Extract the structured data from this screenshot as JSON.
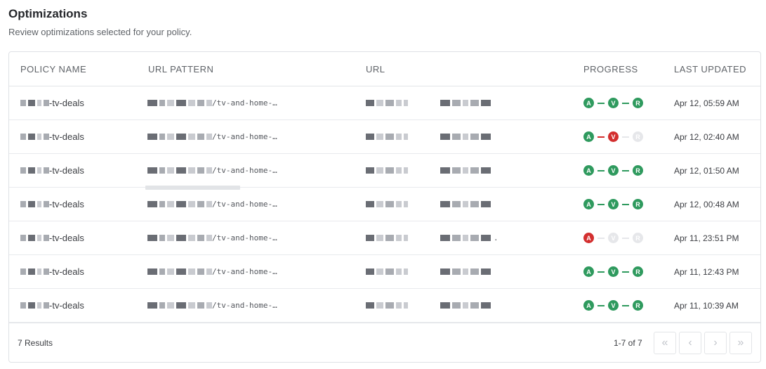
{
  "page": {
    "title": "Optimizations",
    "subtitle": "Review optimizations selected for your policy."
  },
  "table": {
    "headers": {
      "policy_name": "POLICY NAME",
      "url_pattern": "URL PATTERN",
      "url": "URL",
      "progress": "PROGRESS",
      "last_updated": "LAST UPDATED"
    },
    "step_letters": [
      "A",
      "V",
      "R"
    ],
    "colors": {
      "done": "#2f9a5e",
      "fail": "#d32f2f",
      "pending": "#e6e7ea"
    },
    "rows": [
      {
        "policy_suffix": "-tv-deals",
        "pattern_suffix": "/tv-and-home-…",
        "url_suffix": "",
        "progress": [
          "done",
          "done",
          "done"
        ],
        "updated": "Apr 12, 05:59 AM"
      },
      {
        "policy_suffix": "-tv-deals",
        "pattern_suffix": "/tv-and-home-…",
        "url_suffix": "",
        "progress": [
          "done",
          "fail",
          "pending"
        ],
        "updated": "Apr 12, 02:40 AM"
      },
      {
        "policy_suffix": "-tv-deals",
        "pattern_suffix": "/tv-and-home-…",
        "url_suffix": "",
        "progress": [
          "done",
          "done",
          "done"
        ],
        "updated": "Apr 12, 01:50 AM"
      },
      {
        "policy_suffix": "-tv-deals",
        "pattern_suffix": "/tv-and-home-…",
        "url_suffix": "",
        "progress": [
          "done",
          "done",
          "done"
        ],
        "updated": "Apr 12, 00:48 AM"
      },
      {
        "policy_suffix": "-tv-deals",
        "pattern_suffix": "/tv-and-home-…",
        "url_suffix": ".",
        "progress": [
          "fail",
          "pending",
          "pending"
        ],
        "updated": "Apr 11, 23:51 PM"
      },
      {
        "policy_suffix": "-tv-deals",
        "pattern_suffix": "/tv-and-home-…",
        "url_suffix": "",
        "progress": [
          "done",
          "done",
          "done"
        ],
        "updated": "Apr 11, 12:43 PM"
      },
      {
        "policy_suffix": "-tv-deals",
        "pattern_suffix": "/tv-and-home-…",
        "url_suffix": "",
        "progress": [
          "done",
          "done",
          "done"
        ],
        "updated": "Apr 11, 10:39 AM"
      }
    ]
  },
  "footer": {
    "results": "7 Results",
    "range": "1-7 of 7",
    "first_icon": "double-chevron-left-icon",
    "prev_icon": "chevron-left-icon",
    "next_icon": "chevron-right-icon",
    "last_icon": "double-chevron-right-icon"
  }
}
